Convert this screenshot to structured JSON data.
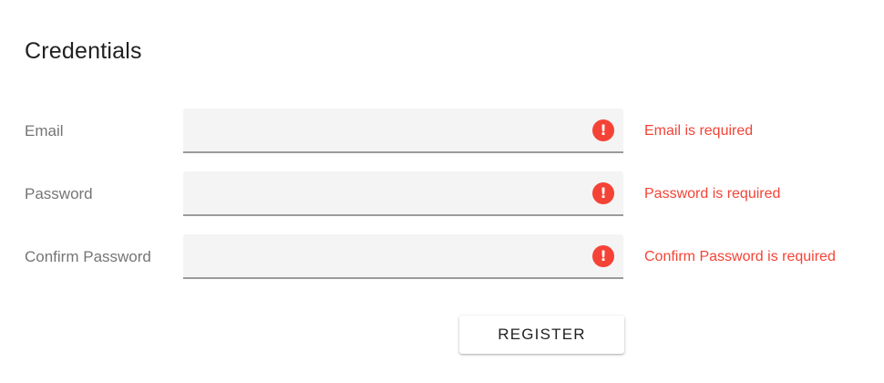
{
  "form": {
    "title": "Credentials",
    "fields": [
      {
        "label": "Email",
        "value": "",
        "error_icon": "exclamation-icon",
        "error": "Email is required"
      },
      {
        "label": "Password",
        "value": "",
        "error_icon": "exclamation-icon",
        "error": "Password is required"
      },
      {
        "label": "Confirm Password",
        "value": "",
        "error_icon": "exclamation-icon",
        "error": "Confirm Password is required"
      }
    ],
    "submit_label": "REGISTER"
  },
  "colors": {
    "error": "#f44336",
    "field_background": "#f4f4f4",
    "label": "#757575",
    "title": "#212121"
  }
}
